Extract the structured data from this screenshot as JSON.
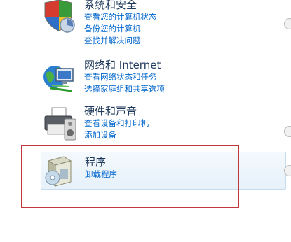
{
  "categories": {
    "system": {
      "title": "系统和安全",
      "links": [
        "查看您的计算机状态",
        "备份您的计算机",
        "查找并解决问题"
      ]
    },
    "network": {
      "title": "网络和 Internet",
      "links": [
        "查看网络状态和任务",
        "选择家庭组和共享选项"
      ]
    },
    "hardware": {
      "title": "硬件和声音",
      "links": [
        "查看设备和打印机",
        "添加设备"
      ]
    },
    "programs": {
      "title": "程序",
      "links": [
        "卸载程序"
      ]
    }
  },
  "colors": {
    "link": "#0066cc",
    "title": "#1e395b",
    "highlight": "#c0383d",
    "selected_bg": "#e6f1fa"
  },
  "icons": {
    "system": "shield-icon",
    "network": "globe-network-icon",
    "hardware": "printer-speaker-icon",
    "programs": "software-box-icon"
  }
}
